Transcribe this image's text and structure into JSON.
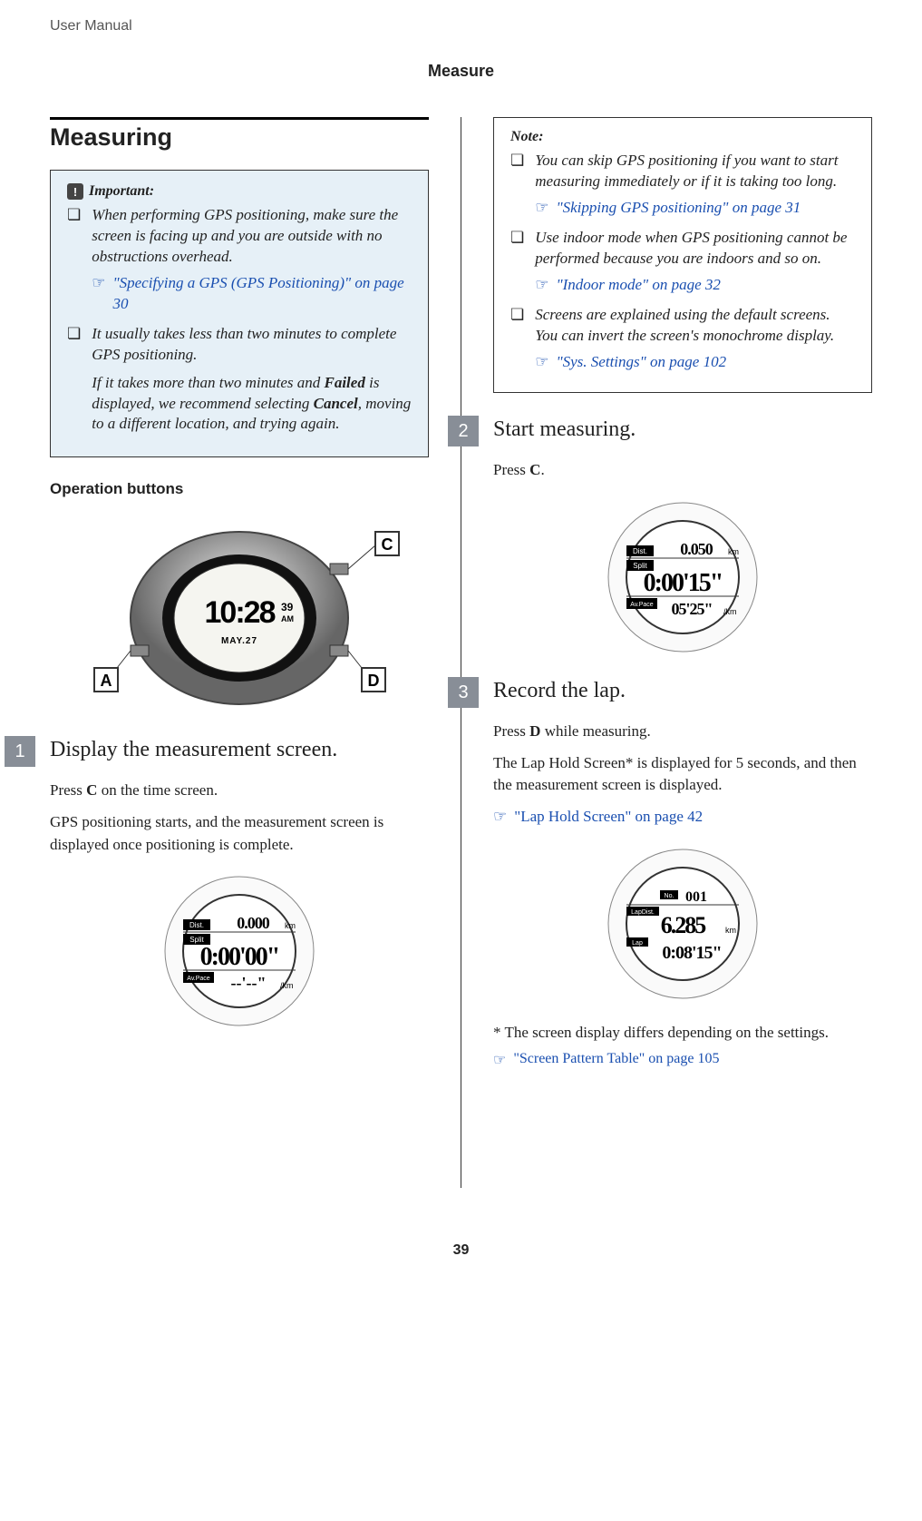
{
  "doc_header": "User Manual",
  "page_title": "Measure",
  "section_title": "Measuring",
  "important": {
    "label": "Important:",
    "items": [
      {
        "text": "When performing GPS positioning, make sure the screen is facing up and you are outside with no obstructions overhead.",
        "xref": "\"Specifying a GPS (GPS Positioning)\" on page 30"
      },
      {
        "text": "It usually takes less than two minutes to complete GPS positioning.",
        "para2a": "If it takes more than two minutes and ",
        "para2b": "Failed",
        "para2c": " is displayed, we recommend selecting ",
        "para2d": "Cancel",
        "para2e": ", moving to a different location, and trying again."
      }
    ]
  },
  "operation_buttons_title": "Operation buttons",
  "button_labels": {
    "a": "A",
    "c": "C",
    "d": "D"
  },
  "watch_time": "10:28",
  "watch_sec": "39",
  "watch_ampm": "AM",
  "watch_date": "MAY.27",
  "steps": [
    {
      "num": "1",
      "title": "Display the measurement screen.",
      "body1a": "Press ",
      "body1b": "C",
      "body1c": " on the time screen.",
      "body2": "GPS positioning starts, and the measurement screen is displayed once positioning is complete.",
      "screen": {
        "dist_lbl": "Dist.",
        "dist_val": "0.000",
        "dist_unit": "km",
        "split_lbl": "Split",
        "split_val": "0:00'00\"",
        "pace_lbl": "Av.Pace",
        "pace_val": "--'--\"",
        "pace_unit": "/km"
      }
    },
    {
      "num": "2",
      "title": "Start measuring.",
      "body1a": "Press ",
      "body1b": "C",
      "body1c": ".",
      "screen": {
        "dist_lbl": "Dist.",
        "dist_val": "0.050",
        "dist_unit": "km",
        "split_lbl": "Split",
        "split_val": "0:00'15\"",
        "pace_lbl": "Av.Pace",
        "pace_val": "05'25\"",
        "pace_unit": "/km"
      }
    },
    {
      "num": "3",
      "title": "Record the lap.",
      "body1a": "Press ",
      "body1b": "D",
      "body1c": " while measuring.",
      "body2": "The Lap Hold Screen* is displayed for 5 seconds, and then the measurement screen is displayed.",
      "xref": "\"Lap Hold Screen\" on page 42",
      "screen": {
        "no_lbl": "No.",
        "no_val": "001",
        "lapdist_lbl": "LapDist.",
        "lapdist_val": "6.285",
        "lapdist_unit": "km",
        "lap_lbl": "Lap",
        "lap_val": "0:08'15\""
      },
      "footnote": "* The screen display differs depending on the settings.",
      "xref2": "\"Screen Pattern Table\" on page 105"
    }
  ],
  "note": {
    "label": "Note:",
    "items": [
      {
        "text": "You can skip GPS positioning if you want to start measuring immediately or if it is taking too long.",
        "xref": "\"Skipping GPS positioning\" on page 31"
      },
      {
        "text": "Use indoor mode when GPS positioning cannot be performed because you are indoors and so on.",
        "xref": "\"Indoor mode\" on page 32"
      },
      {
        "text": "Screens are explained using the default screens. You can invert the screen's monochrome display.",
        "xref": "\"Sys. Settings\" on page 102"
      }
    ]
  },
  "page_num": "39"
}
